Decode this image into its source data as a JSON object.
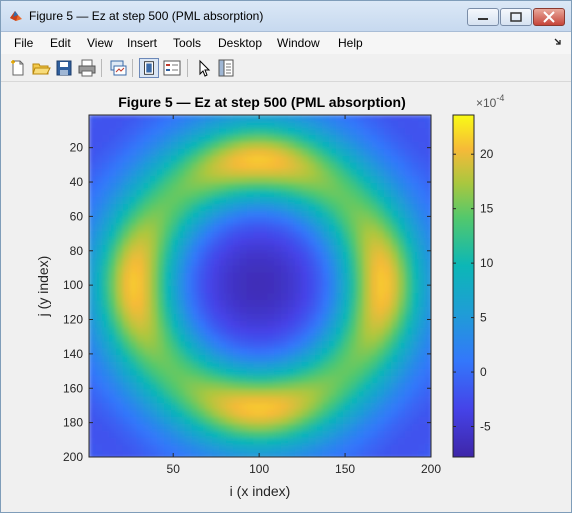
{
  "window": {
    "title": "Figure 5 — Ez at step 500 (PML absorption)"
  },
  "menu": {
    "items": [
      "File",
      "Edit",
      "View",
      "Insert",
      "Tools",
      "Desktop",
      "Window",
      "Help"
    ]
  },
  "toolbar": {
    "icons": [
      "new-figure-icon",
      "open-file-icon",
      "save-icon",
      "print-icon",
      "link-plot-icon",
      "dock-figure-icon",
      "insert-legend-icon",
      "pointer-icon",
      "property-editor-icon"
    ]
  },
  "colors": {
    "titlebar": "#c7d9ef",
    "close_button": "#c6453a",
    "colormap": "parula"
  },
  "chart_data": {
    "type": "heatmap",
    "title": "Figure 5 — Ez at step 500 (PML absorption)",
    "xlabel": "i (x index)",
    "ylabel": "j (y index)",
    "x_range": [
      1,
      200
    ],
    "y_range": [
      1,
      200
    ],
    "y_direction": "reversed",
    "x_ticks": [
      "50",
      "100",
      "150",
      "200"
    ],
    "y_ticks": [
      "20",
      "40",
      "60",
      "80",
      "100",
      "120",
      "140",
      "160",
      "180",
      "200"
    ],
    "colorbar": {
      "exponent_label": "×10",
      "exponent": "-4",
      "ticks": [
        "20",
        "15",
        "10",
        "5",
        "0",
        "-5"
      ],
      "range": [
        -7.8,
        23.6
      ]
    },
    "grid": false
  }
}
